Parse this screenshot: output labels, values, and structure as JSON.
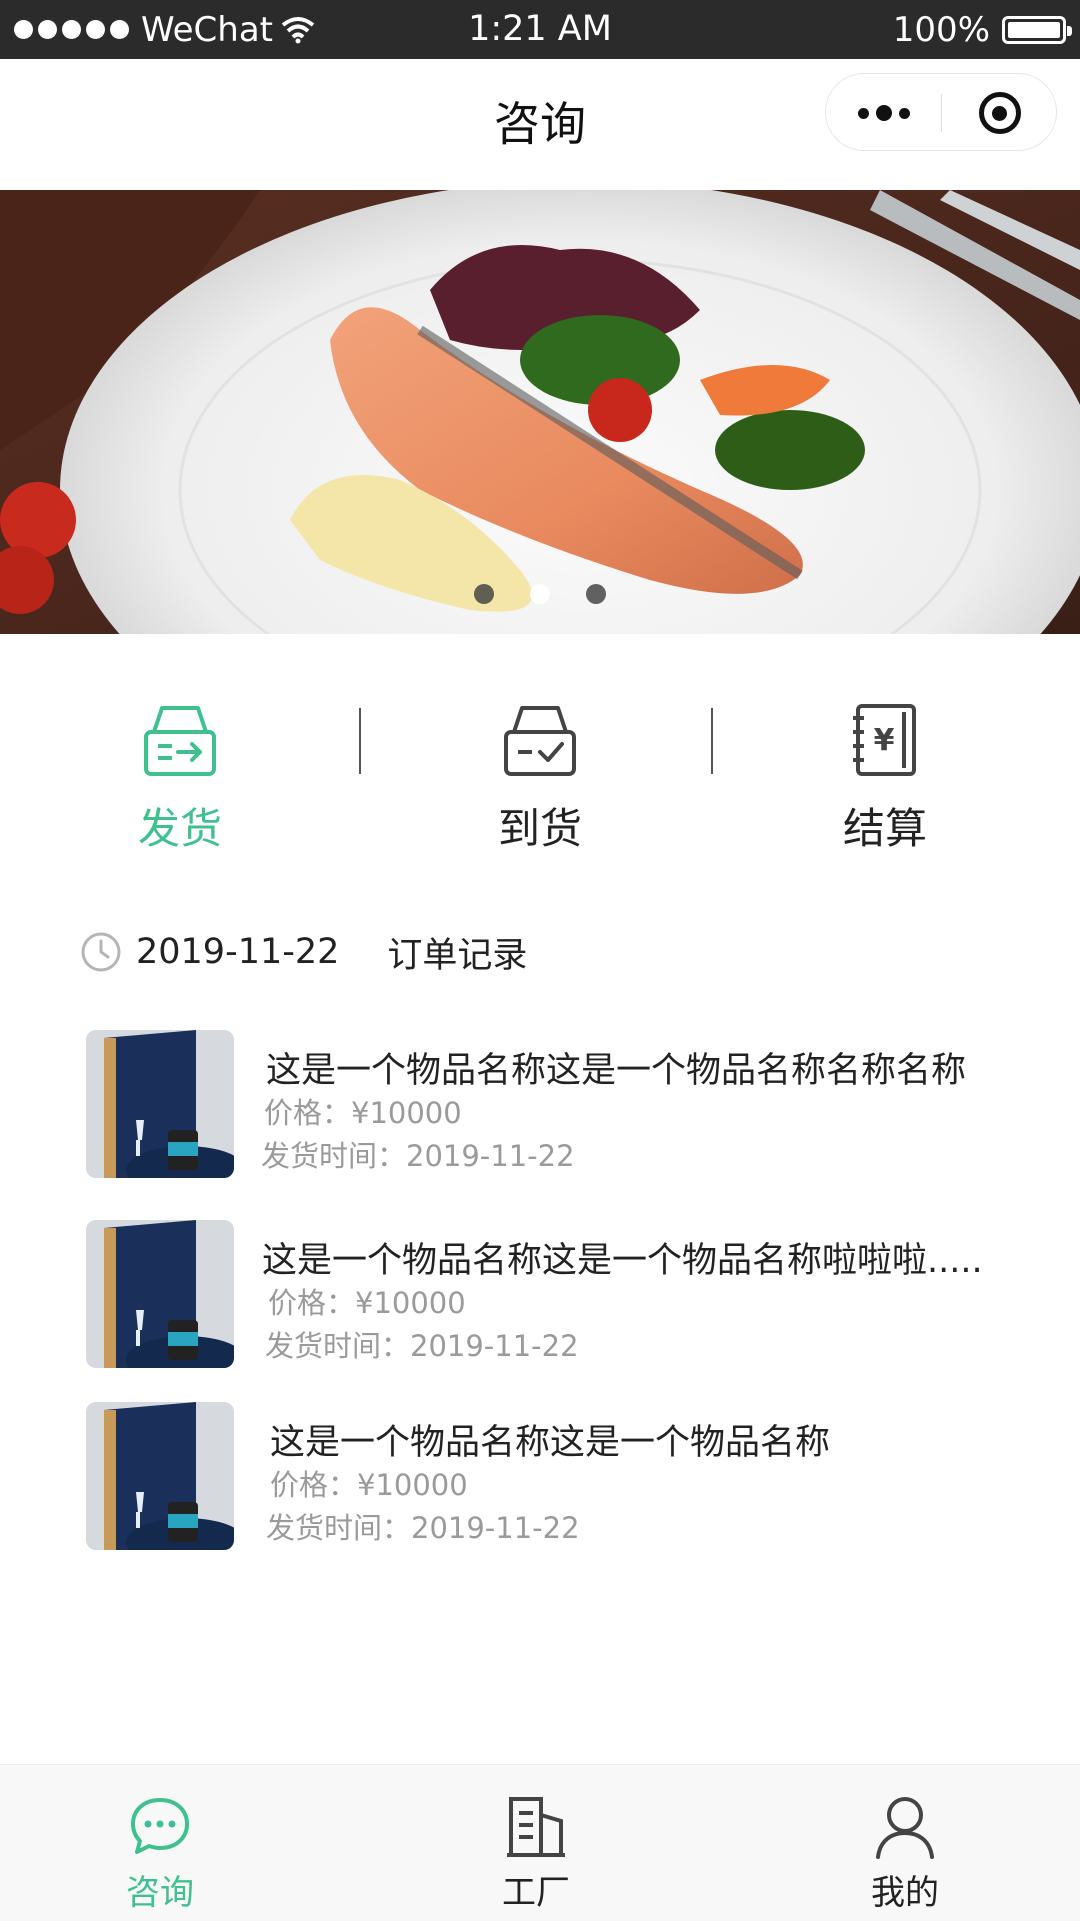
{
  "status_bar": {
    "carrier": "WeChat",
    "time": "1:21 AM",
    "battery": "100%"
  },
  "nav": {
    "title": "咨询"
  },
  "banner": {
    "slide_count": 3,
    "active_index": 1
  },
  "actions": [
    {
      "label": "发货",
      "icon": "ship-box-icon",
      "active": true
    },
    {
      "label": "到货",
      "icon": "arrival-box-icon",
      "active": false
    },
    {
      "label": "结算",
      "icon": "ledger-yen-icon",
      "active": false
    }
  ],
  "orders": {
    "date": "2019-11-22",
    "title": "订单记录",
    "items": [
      {
        "name": "这是一个物品名称这是一个物品名称名称名称",
        "price": "价格：¥10000",
        "ship_time": "发货时间：2019-11-22"
      },
      {
        "name": "这是一个物品名称这是一个物品名称啦啦啦.....",
        "price": "价格：¥10000",
        "ship_time": "发货时间：2019-11-22"
      },
      {
        "name": "这是一个物品名称这是一个物品名称",
        "price": "价格：¥10000",
        "ship_time": "发货时间：2019-11-22"
      }
    ]
  },
  "tabbar": [
    {
      "label": "咨询",
      "icon": "chat-bubble-icon",
      "active": true
    },
    {
      "label": "工厂",
      "icon": "building-icon",
      "active": false
    },
    {
      "label": "我的",
      "icon": "user-icon",
      "active": false
    }
  ],
  "colors": {
    "accent": "#3ec18f",
    "status_bar": "#2b2b2b",
    "text": "#222222",
    "muted": "#9a9a9a"
  }
}
